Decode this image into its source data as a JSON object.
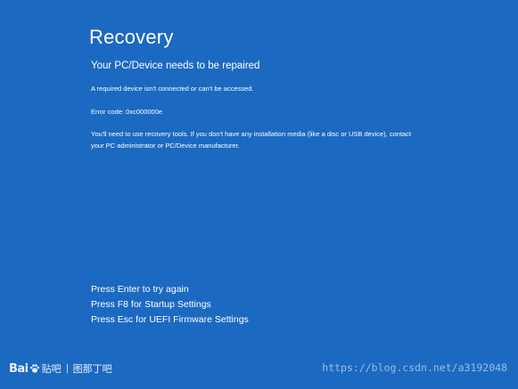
{
  "screen": {
    "title": "Recovery",
    "subtitle": "Your PC/Device needs to be repaired",
    "message": "A required device isn't connected or can't be accessed.",
    "error_code": "Error code: 0xc000000e",
    "info": "You'll need to use recovery tools. If you don't have any installation media (like a disc or USB device), contact your PC administrator or PC/Device manufacturer.",
    "actions": [
      "Press Enter to try again",
      "Press F8 for Startup Settings",
      "Press Esc for UEFI Firmware Settings"
    ],
    "background_color": "#1c69c1"
  },
  "watermark": {
    "logo_text_left": "Bai",
    "logo_icon": "paw-icon",
    "tieba": "贴吧",
    "author": "图那丁吧",
    "url": "https://blog.csdn.net/a3192048"
  }
}
